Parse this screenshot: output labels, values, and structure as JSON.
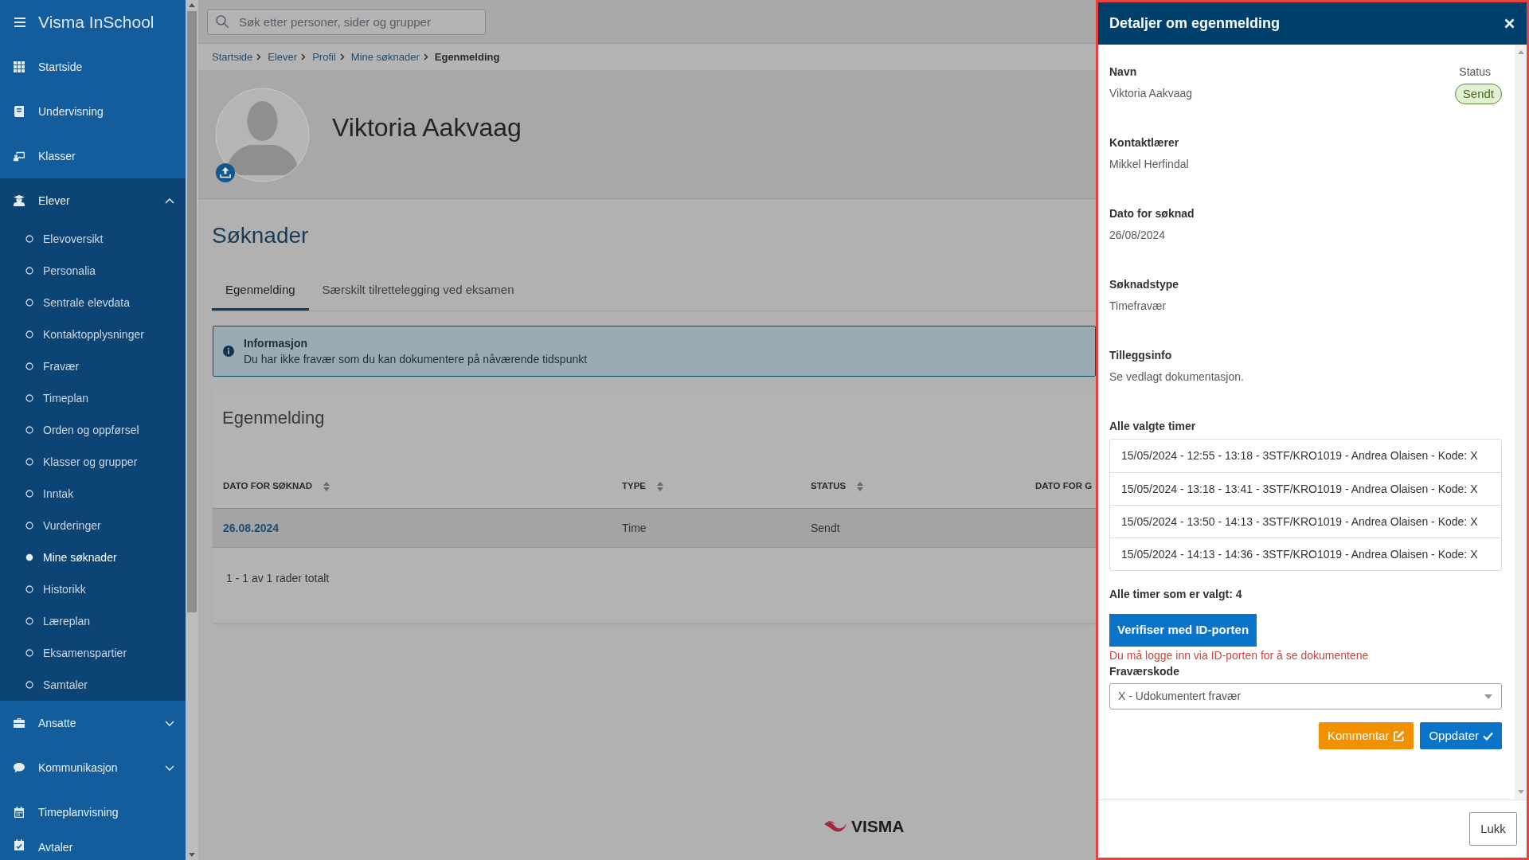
{
  "sidebar": {
    "title": "Visma InSchool",
    "items": [
      {
        "kind": "link",
        "label": "Startside"
      },
      {
        "kind": "link",
        "label": "Undervisning"
      },
      {
        "kind": "link",
        "label": "Klasser"
      },
      {
        "kind": "group",
        "label": "Elever",
        "expanded": true,
        "children": [
          {
            "label": "Elevoversikt",
            "selected": false
          },
          {
            "label": "Personalia",
            "selected": false
          },
          {
            "label": "Sentrale elevdata",
            "selected": false
          },
          {
            "label": "Kontaktopplysninger",
            "selected": false
          },
          {
            "label": "Fravær",
            "selected": false
          },
          {
            "label": "Timeplan",
            "selected": false
          },
          {
            "label": "Orden og oppførsel",
            "selected": false
          },
          {
            "label": "Klasser og grupper",
            "selected": false
          },
          {
            "label": "Inntak",
            "selected": false
          },
          {
            "label": "Vurderinger",
            "selected": false
          },
          {
            "label": "Mine søknader",
            "selected": true
          },
          {
            "label": "Historikk",
            "selected": false
          },
          {
            "label": "Læreplan",
            "selected": false
          },
          {
            "label": "Eksamenspartier",
            "selected": false
          },
          {
            "label": "Samtaler",
            "selected": false
          }
        ]
      },
      {
        "kind": "group",
        "label": "Ansatte",
        "expanded": false
      },
      {
        "kind": "group",
        "label": "Kommunikasjon",
        "expanded": false
      },
      {
        "kind": "link",
        "label": "Timeplanvisning"
      },
      {
        "kind": "link",
        "label": "Avtaler"
      }
    ]
  },
  "search": {
    "placeholder": "Søk etter personer, sider og grupper"
  },
  "breadcrumb": [
    {
      "label": "Startside",
      "current": false
    },
    {
      "label": "Elever",
      "current": false
    },
    {
      "label": "Profil",
      "current": false
    },
    {
      "label": "Mine søknader",
      "current": false
    },
    {
      "label": "Egenmelding",
      "current": true
    }
  ],
  "profile": {
    "name": "Viktoria Aakvaag"
  },
  "page_title": "Søknader",
  "tabs": [
    {
      "label": "Egenmelding",
      "selected": true
    },
    {
      "label": "Særskilt tilrettelegging ved eksamen",
      "selected": false
    }
  ],
  "info": {
    "title": "Informasjon",
    "text": "Du har ikke fravær som du kan dokumentere på nåværende tidspunkt"
  },
  "card": {
    "title": "Egenmelding",
    "table": {
      "columns": [
        {
          "label": "DATO FOR SØKNAD",
          "sortable": true
        },
        {
          "label": "TYPE",
          "sortable": true
        },
        {
          "label": "STATUS",
          "sortable": true
        },
        {
          "label": "DATO FOR G",
          "sortable": false
        }
      ],
      "rows": [
        {
          "selected": true,
          "cells": [
            "26.08.2024",
            "Time",
            "Sendt"
          ]
        }
      ]
    },
    "pagination": "1 - 1 av 1 rader totalt"
  },
  "footer": {
    "logo_text": "VISMA"
  },
  "panel": {
    "title": "Detaljer om egenmelding",
    "fields": [
      {
        "label": "Navn",
        "value": "Viktoria Aakvaag"
      },
      {
        "label": "Kontaktlærer",
        "value": "Mikkel Herfindal"
      },
      {
        "label": "Dato for søknad",
        "value": "26/08/2024"
      },
      {
        "label": "Søknadstype",
        "value": "Timefravær"
      },
      {
        "label": "Tilleggsinfo",
        "value": "Se vedlagt dokumentasjon."
      }
    ],
    "status": {
      "label": "Status",
      "value": "Sendt"
    },
    "hours": {
      "label": "Alle valgte timer",
      "items": [
        "15/05/2024 - 12:55 - 13:18 - 3STF/KRO1019 - Andrea Olaisen - Kode: X",
        "15/05/2024 - 13:18 - 13:41 - 3STF/KRO1019 - Andrea Olaisen - Kode: X",
        "15/05/2024 - 13:50 - 14:13 - 3STF/KRO1019 - Andrea Olaisen - Kode: X",
        "15/05/2024 - 14:13 - 14:36 - 3STF/KRO1019 - Andrea Olaisen - Kode: X"
      ]
    },
    "hours_total": "Alle timer som er valgt: 4",
    "verify_button": "Verifiser med ID-porten",
    "error": "Du må logge inn via ID-porten for å se dokumentene",
    "absence_code": {
      "label": "Fraværskode",
      "value": "X - Udokumentert fravær"
    },
    "actions": [
      {
        "kind": "comment",
        "label": "Kommentar"
      },
      {
        "kind": "update",
        "label": "Oppdater"
      }
    ],
    "close_button": "Lukk"
  }
}
